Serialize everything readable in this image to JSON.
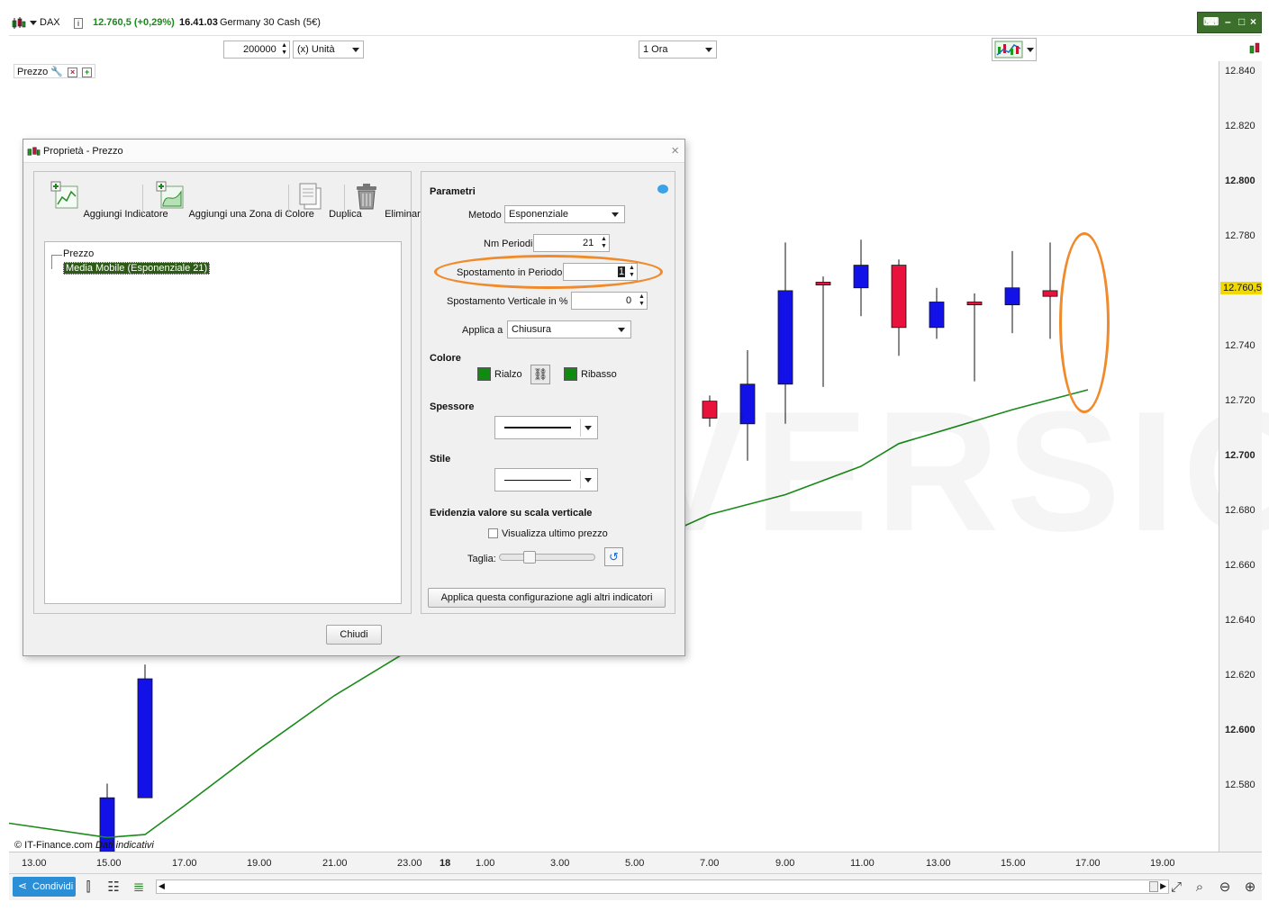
{
  "header": {
    "symbol": "DAX",
    "info_icon": "i",
    "price_change": "12.760,5 (+0,29%)",
    "time": "16.41.03",
    "instrument": "Germany 30 Cash (5€)"
  },
  "toolbar": {
    "quantity": "200000",
    "unit": "(x) Unità",
    "timeframe": "1 Ora"
  },
  "colors": {
    "up_candle": "#1212e8",
    "down_candle": "#e8123c",
    "moving_average": "#1a8a1a",
    "highlight": "#f08a2a",
    "price_tag": "#f0d800"
  },
  "chart": {
    "legend_label": "Prezzo",
    "watermark": "DEMO VERSION",
    "copyright": "© IT-Finance.com",
    "copyright_note": "Dati indicativi",
    "current_price": "12.760,5",
    "y_labels": [
      {
        "text": "12.840",
        "bold": false
      },
      {
        "text": "12.820",
        "bold": false
      },
      {
        "text": "12.800",
        "bold": true
      },
      {
        "text": "12.780",
        "bold": false
      },
      {
        "text": "12.740",
        "bold": false
      },
      {
        "text": "12.720",
        "bold": false
      },
      {
        "text": "12.700",
        "bold": true
      },
      {
        "text": "12.680",
        "bold": false
      },
      {
        "text": "12.660",
        "bold": false
      },
      {
        "text": "12.640",
        "bold": false
      },
      {
        "text": "12.620",
        "bold": false
      },
      {
        "text": "12.600",
        "bold": true
      },
      {
        "text": "12.580",
        "bold": false
      }
    ],
    "x_labels": [
      "13.00",
      "15.00",
      "17.00",
      "19.00",
      "21.00",
      "23.00",
      "18",
      "1.00",
      "3.00",
      "5.00",
      "7.00",
      "9.00",
      "11.00",
      "13.00",
      "15.00",
      "17.00",
      "19.00"
    ]
  },
  "chart_data": {
    "type": "candlestick",
    "title": "",
    "xlabel": "",
    "ylabel": "",
    "ylim": [
      12564,
      12843
    ],
    "candles": [
      {
        "x": "15.00",
        "open": 12563,
        "high": 12588,
        "low": 12563,
        "close": 12583
      },
      {
        "x": "16.00",
        "open": 12583,
        "high": 12630,
        "low": 12583,
        "close": 12625
      },
      {
        "x": "7.00",
        "open": 12723,
        "high": 12725,
        "low": 12714,
        "close": 12717
      },
      {
        "x": "8.00",
        "open": 12715,
        "high": 12741,
        "low": 12702,
        "close": 12729
      },
      {
        "x": "9.00",
        "open": 12729,
        "high": 12779,
        "low": 12715,
        "close": 12762
      },
      {
        "x": "10.00",
        "open": 12765,
        "high": 12767,
        "low": 12728,
        "close": 12764
      },
      {
        "x": "11.00",
        "open": 12763,
        "high": 12780,
        "low": 12753,
        "close": 12771
      },
      {
        "x": "12.00",
        "open": 12771,
        "high": 12773,
        "low": 12739,
        "close": 12749
      },
      {
        "x": "13.00",
        "open": 12749,
        "high": 12763,
        "low": 12745,
        "close": 12758
      },
      {
        "x": "14.00",
        "open": 12758,
        "high": 12761,
        "low": 12730,
        "close": 12757
      },
      {
        "x": "15.00",
        "open": 12757,
        "high": 12776,
        "low": 12747,
        "close": 12763
      },
      {
        "x": "16.00",
        "open": 12762,
        "high": 12779,
        "low": 12745,
        "close": 12760
      }
    ],
    "moving_average": {
      "name": "Media Mobile (Esponenziale 21)",
      "values": [
        {
          "x": "12.00",
          "y": 12574
        },
        {
          "x": "15.00",
          "y": 12569
        },
        {
          "x": "16.00",
          "y": 12570
        },
        {
          "x": "17.00",
          "y": 12580
        },
        {
          "x": "19.00",
          "y": 12600
        },
        {
          "x": "21.00",
          "y": 12619
        },
        {
          "x": "23.00",
          "y": 12635
        },
        {
          "x": "7.00",
          "y": 12683
        },
        {
          "x": "9.00",
          "y": 12690
        },
        {
          "x": "11.00",
          "y": 12700
        },
        {
          "x": "12.00",
          "y": 12708
        },
        {
          "x": "13.00",
          "y": 12712
        },
        {
          "x": "15.00",
          "y": 12720
        },
        {
          "x": "17.00",
          "y": 12727
        }
      ]
    }
  },
  "dialog": {
    "title": "Proprietà - Prezzo",
    "tools": {
      "add_indicator": "Aggiungi Indicatore",
      "add_color_zone": "Aggiungi una Zona di Colore",
      "duplicate": "Duplica",
      "delete": "Eliminare"
    },
    "tree": {
      "root": "Prezzo",
      "child": "Media Mobile (Esponenziale 21)"
    },
    "params": {
      "section": "Parametri",
      "method_label": "Metodo",
      "method_value": "Esponenziale",
      "periods_label": "Nm Periodi",
      "periods_value": "21",
      "shift_label": "Spostamento in Periodo",
      "shift_value": "1",
      "vshift_label": "Spostamento Verticale in %",
      "vshift_value": "0",
      "apply_label": "Applica a",
      "apply_value": "Chiusura"
    },
    "color": {
      "section": "Colore",
      "up": "Rialzo",
      "down": "Ribasso"
    },
    "thickness_section": "Spessore",
    "style_section": "Stile",
    "highlight_section": "Evidenzia valore su scala verticale",
    "show_last_price": "Visualizza ultimo prezzo",
    "size_label": "Taglia:",
    "apply_all": "Applica questa configurazione agli altri indicatori",
    "close": "Chiudi"
  },
  "bottombar": {
    "share": "Condividi"
  }
}
